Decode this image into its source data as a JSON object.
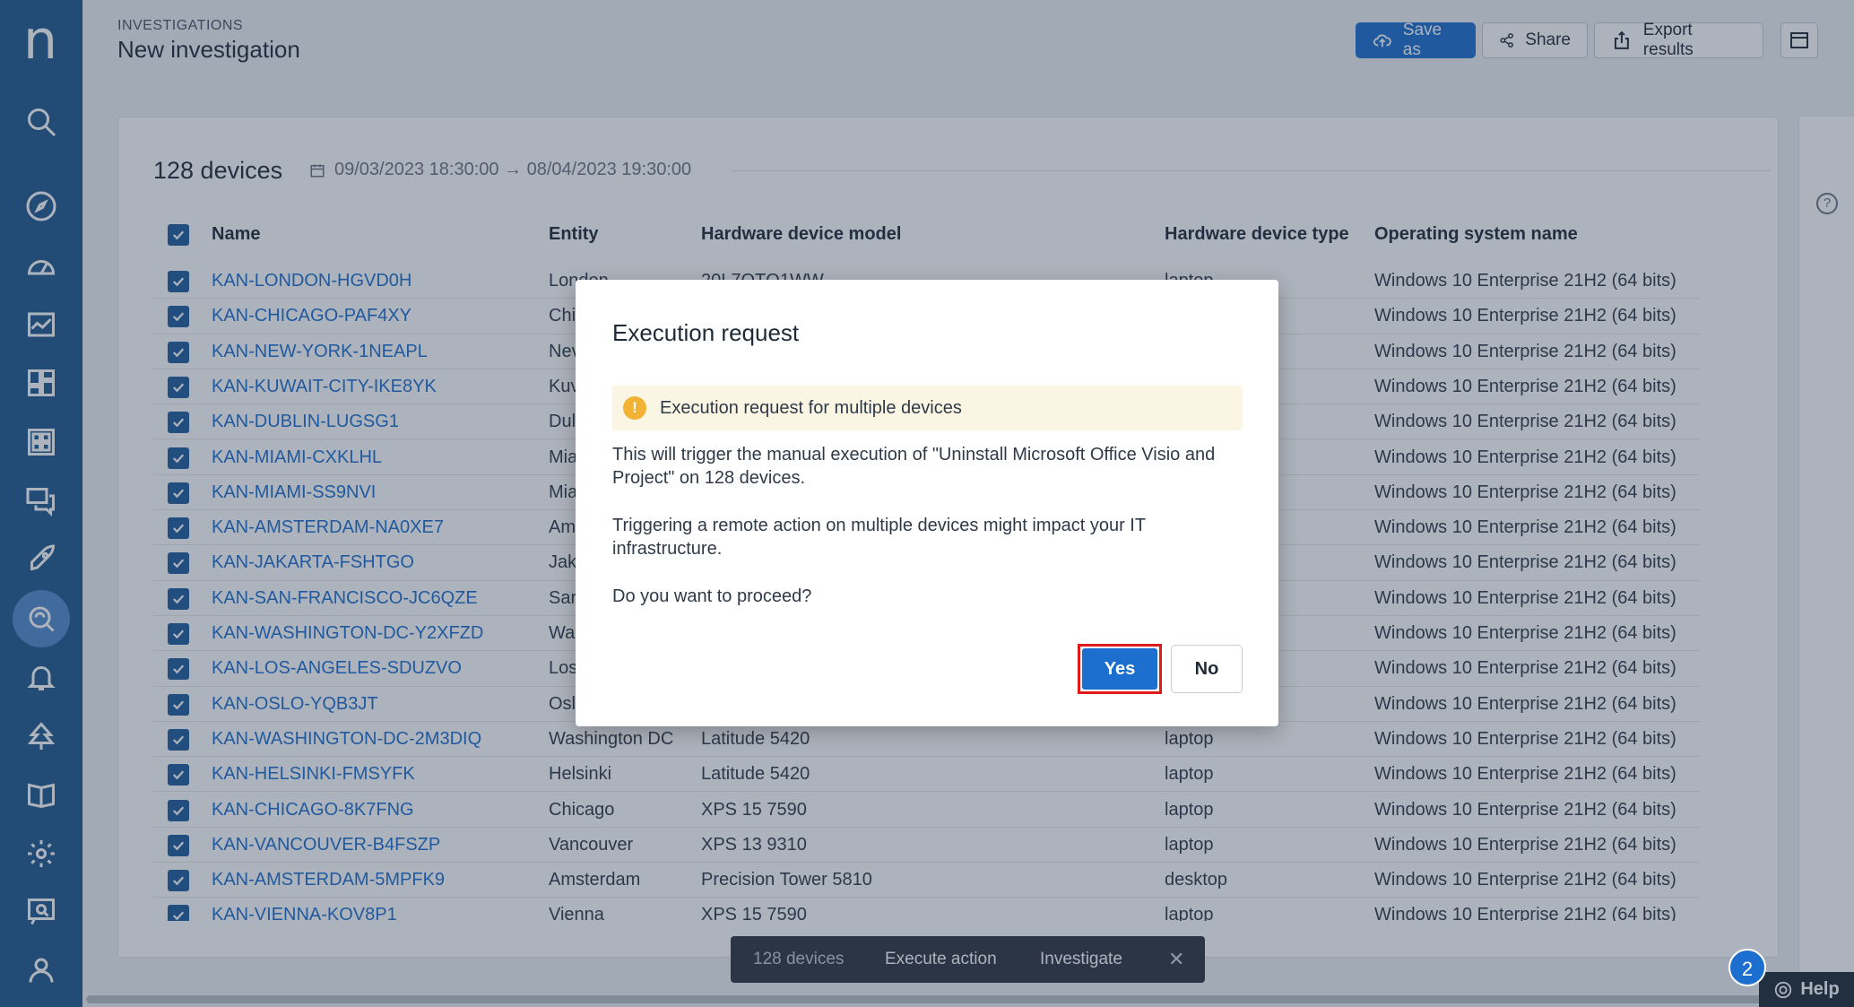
{
  "app": {
    "logo": "n",
    "breadcrumb": "INVESTIGATIONS",
    "title": "New investigation"
  },
  "toolbar": {
    "save_label": "Save as",
    "share_label": "Share",
    "export_label": "Export results"
  },
  "sidebar_icons": [
    "search-icon",
    "compass-icon",
    "dashboard-gauge-icon",
    "chart-icon",
    "layout-icon",
    "grid-icon",
    "chat-icon",
    "rocket-icon",
    "investigation-icon",
    "bell-icon",
    "tree-icon",
    "book-icon",
    "gear-icon",
    "feedback-icon",
    "user-icon"
  ],
  "results": {
    "count_label": "128 devices",
    "date_range": "09/03/2023 18:30:00 → 08/04/2023 19:30:00",
    "columns": [
      "Name",
      "Entity",
      "Hardware device model",
      "Hardware device type",
      "Operating system name"
    ],
    "rows": [
      {
        "name": "KAN-LONDON-HGVD0H",
        "entity": "London",
        "model": "20L7QTQ1WW",
        "type": "laptop",
        "os": "Windows 10 Enterprise 21H2 (64 bits)"
      },
      {
        "name": "KAN-CHICAGO-PAF4XY",
        "entity": "Chi",
        "model": "",
        "type": "",
        "os": "Windows 10 Enterprise 21H2 (64 bits)"
      },
      {
        "name": "KAN-NEW-YORK-1NEAPL",
        "entity": "Nev",
        "model": "",
        "type": "",
        "os": "Windows 10 Enterprise 21H2 (64 bits)"
      },
      {
        "name": "KAN-KUWAIT-CITY-IKE8YK",
        "entity": "Kuv",
        "model": "",
        "type": "",
        "os": "Windows 10 Enterprise 21H2 (64 bits)"
      },
      {
        "name": "KAN-DUBLIN-LUGSG1",
        "entity": "Dul",
        "model": "",
        "type": "",
        "os": "Windows 10 Enterprise 21H2 (64 bits)"
      },
      {
        "name": "KAN-MIAMI-CXKLHL",
        "entity": "Mia",
        "model": "",
        "type": "",
        "os": "Windows 10 Enterprise 21H2 (64 bits)"
      },
      {
        "name": "KAN-MIAMI-SS9NVI",
        "entity": "Mia",
        "model": "",
        "type": "",
        "os": "Windows 10 Enterprise 21H2 (64 bits)"
      },
      {
        "name": "KAN-AMSTERDAM-NA0XE7",
        "entity": "Am",
        "model": "",
        "type": "",
        "os": "Windows 10 Enterprise 21H2 (64 bits)"
      },
      {
        "name": "KAN-JAKARTA-FSHTGO",
        "entity": "Jak",
        "model": "",
        "type": "",
        "os": "Windows 10 Enterprise 21H2 (64 bits)"
      },
      {
        "name": "KAN-SAN-FRANCISCO-JC6QZE",
        "entity": "Sar",
        "model": "",
        "type": "",
        "os": "Windows 10 Enterprise 21H2 (64 bits)"
      },
      {
        "name": "KAN-WASHINGTON-DC-Y2XFZD",
        "entity": "Wa",
        "model": "",
        "type": "",
        "os": "Windows 10 Enterprise 21H2 (64 bits)"
      },
      {
        "name": "KAN-LOS-ANGELES-SDUZVO",
        "entity": "Los",
        "model": "",
        "type": "",
        "os": "Windows 10 Enterprise 21H2 (64 bits)"
      },
      {
        "name": "KAN-OSLO-YQB3JT",
        "entity": "Osl",
        "model": "",
        "type": "",
        "os": "Windows 10 Enterprise 21H2 (64 bits)"
      },
      {
        "name": "KAN-WASHINGTON-DC-2M3DIQ",
        "entity": "Washington DC",
        "model": "Latitude 5420",
        "type": "laptop",
        "os": "Windows 10 Enterprise 21H2 (64 bits)"
      },
      {
        "name": "KAN-HELSINKI-FMSYFK",
        "entity": "Helsinki",
        "model": "Latitude 5420",
        "type": "laptop",
        "os": "Windows 10 Enterprise 21H2 (64 bits)"
      },
      {
        "name": "KAN-CHICAGO-8K7FNG",
        "entity": "Chicago",
        "model": "XPS 15 7590",
        "type": "laptop",
        "os": "Windows 10 Enterprise 21H2 (64 bits)"
      },
      {
        "name": "KAN-VANCOUVER-B4FSZP",
        "entity": "Vancouver",
        "model": "XPS 13 9310",
        "type": "laptop",
        "os": "Windows 10 Enterprise 21H2 (64 bits)"
      },
      {
        "name": "KAN-AMSTERDAM-5MPFK9",
        "entity": "Amsterdam",
        "model": "Precision Tower 5810",
        "type": "desktop",
        "os": "Windows 10 Enterprise 21H2 (64 bits)"
      },
      {
        "name": "KAN-VIENNA-KOV8P1",
        "entity": "Vienna",
        "model": "XPS 15 7590",
        "type": "laptop",
        "os": "Windows 10 Enterprise 21H2 (64 bits)"
      }
    ]
  },
  "action_bar": {
    "count": "128 devices",
    "execute": "Execute action",
    "investigate": "Investigate",
    "close": "✕"
  },
  "help": {
    "badge": "2",
    "label": "Help"
  },
  "modal": {
    "title": "Execution request",
    "alert": "Execution request for multiple devices",
    "alert_icon": "!",
    "line1": "This will trigger the manual execution of \"Uninstall Microsoft Office Visio and Project\" on 128 devices.",
    "line2": "Triggering a remote action on multiple devices might impact your IT infrastructure.",
    "line3": "Do you want to proceed?",
    "yes": "Yes",
    "no": "No"
  },
  "colors": {
    "sidebar": "#1f5a8f",
    "accent": "#1d6fcf",
    "highlight": "#e01b1b",
    "alert_bg": "#fbf6e4"
  }
}
